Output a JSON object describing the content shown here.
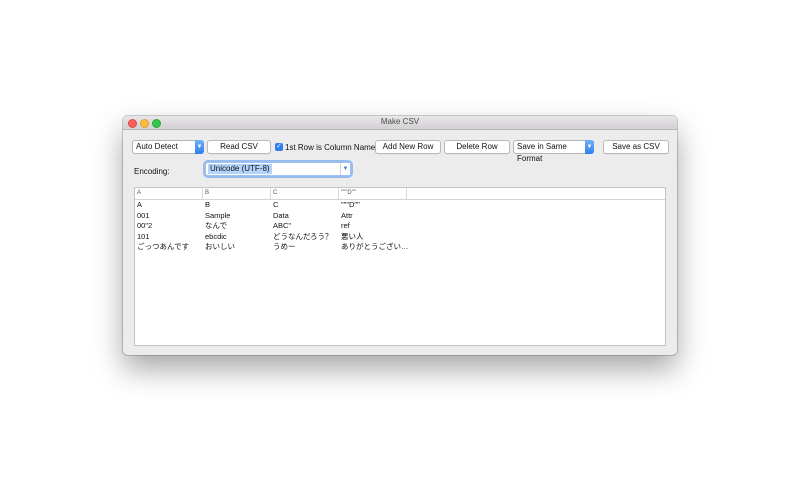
{
  "window": {
    "title": "Make CSV"
  },
  "toolbar": {
    "detect_value": "Auto Detect",
    "read_csv_label": "Read CSV",
    "first_row_label": "1st Row is Column Name",
    "first_row_checked": true,
    "add_row_label": "Add New Row",
    "delete_row_label": "Delete Row",
    "save_format_value": "Save in Same Format",
    "save_csv_label": "Save as CSV"
  },
  "encoding": {
    "label": "Encoding:",
    "value": "Unicode (UTF-8)"
  },
  "table": {
    "headers": [
      "A",
      "B",
      "C",
      "\"\"\"D\"\""
    ],
    "rows": [
      [
        "A",
        "B",
        "C",
        "\"\"\"D\"\""
      ],
      [
        "001",
        "Sample",
        "Data",
        "Attr"
      ],
      [
        "00\"2",
        "なんで",
        "ABC\"",
        "ref"
      ],
      [
        "101",
        "ebcdic",
        "どうなんだろう？",
        "悪い人"
      ],
      [
        "ごっつあんです",
        "おいしい",
        "うめー",
        "ありがとうござい…"
      ]
    ]
  },
  "colors": {
    "accent": "#2f7ff0",
    "window_bg": "#ececec"
  }
}
